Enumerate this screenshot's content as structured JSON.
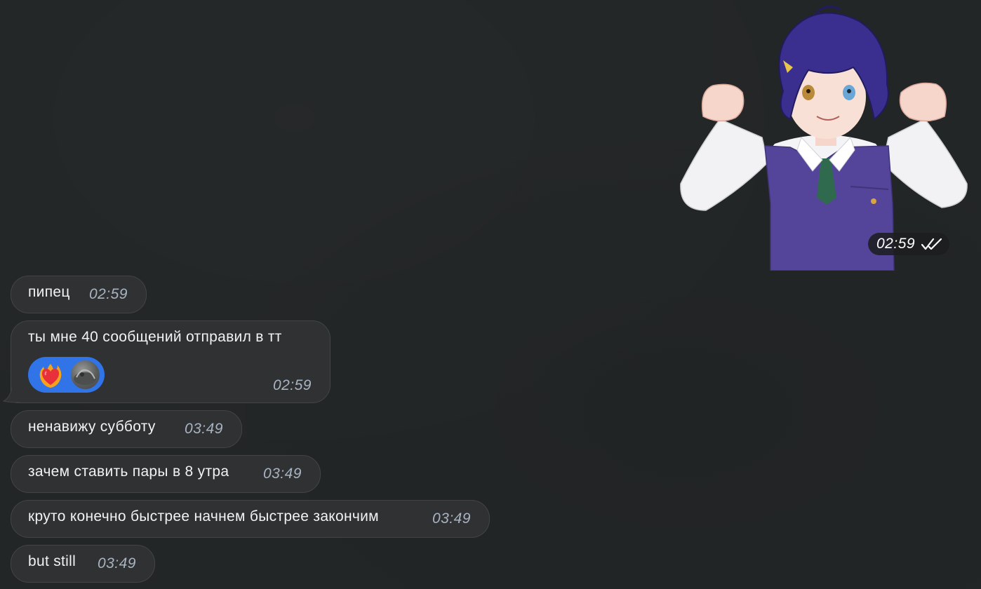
{
  "sticker": {
    "time": "02:59",
    "status_icon": "double-check-read-icon"
  },
  "messages": [
    {
      "text": "пипец",
      "time": "02:59"
    },
    {
      "text": "ты мне 40 сообщений отправил в тт",
      "time": "02:59",
      "reactions": {
        "emoji": "heart-on-fire-emoji",
        "reactor": "avatar"
      }
    },
    {
      "text": "ненавижу субботу",
      "time": "03:49"
    },
    {
      "text": "зачем ставить пары в 8 утра",
      "time": "03:49"
    },
    {
      "text": "круто конечно быстрее начнем быстрее закончим",
      "time": "03:49"
    },
    {
      "text": "but still",
      "time": "03:49"
    }
  ],
  "colors": {
    "background": "#232627",
    "bubble": "#2f3132",
    "bubble_border": "#424445",
    "time": "#a9b4c2",
    "reaction_accent": "#3174e8"
  }
}
